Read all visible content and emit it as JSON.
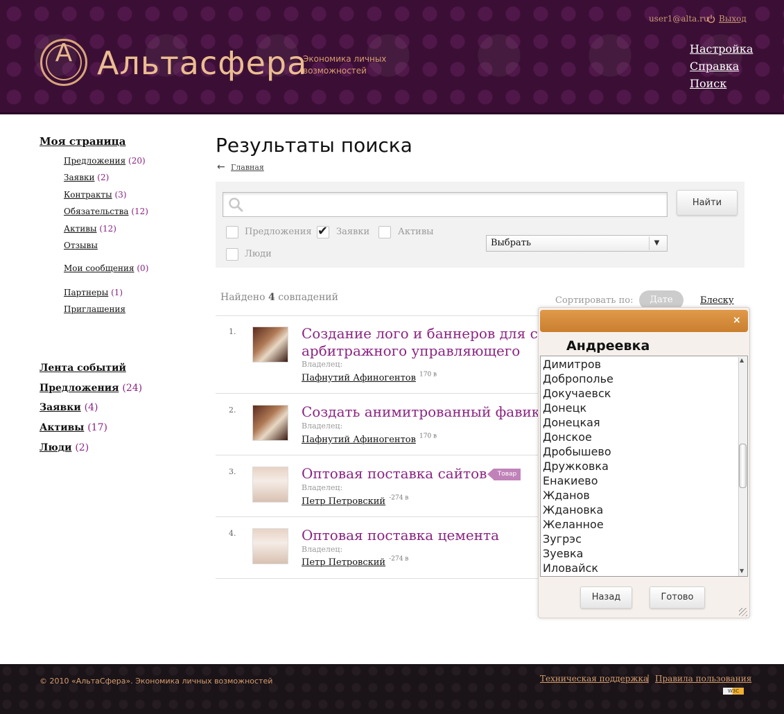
{
  "header": {
    "logo_letter": "A",
    "brand": "Альтасфера",
    "tagline": "Экономика личных возможностей",
    "user_email": "user1@alta.ru",
    "logout": "Выход",
    "links": [
      "Настройка",
      "Справка",
      "Поиск"
    ]
  },
  "sidebar": {
    "my_page": "Моя страница",
    "items": [
      {
        "label": "Предложения",
        "count": "(20)"
      },
      {
        "label": "Заявки",
        "count": "(2)"
      },
      {
        "label": "Контракты",
        "count": "(3)"
      },
      {
        "label": "Обязательства",
        "count": "(12)"
      },
      {
        "label": "Активы",
        "count": "(12)"
      },
      {
        "label": "Отзывы",
        "count": ""
      }
    ],
    "messages": {
      "label": "Мои сообщения",
      "count": "(0)"
    },
    "partners": {
      "label": "Партнеры",
      "count": "(1)"
    },
    "invites": "Приглашения",
    "feed": "Лента событий",
    "sections": [
      {
        "label": "Предложения",
        "count": "(24)"
      },
      {
        "label": "Заявки",
        "count": "(4)"
      },
      {
        "label": "Активы",
        "count": "(17)"
      },
      {
        "label": "Люди",
        "count": "(2)"
      }
    ]
  },
  "main": {
    "title": "Результаты поиска",
    "breadcrumb": "Главная",
    "search": {
      "value": "",
      "placeholder": "",
      "button": "Найти"
    },
    "filters": [
      {
        "label": "Предложения",
        "checked": false
      },
      {
        "label": "Заявки",
        "checked": true
      },
      {
        "label": "Активы",
        "checked": false
      },
      {
        "label": "Люди",
        "checked": false
      }
    ],
    "select_value": "Выбрать",
    "found_prefix": "Найдено",
    "found_count": "4",
    "found_suffix": "совпадений",
    "sort_label": "Сортировать по:",
    "sort_options": [
      "Дате",
      "Блеску"
    ],
    "owner_label": "Владелец:",
    "results": [
      {
        "num": "1.",
        "title_line1": "Создание лого и баннеров для са",
        "title_line2": "арбитражного управляющего",
        "owner": "Пафнутий Афиногентов",
        "price": "170 в",
        "tag": ""
      },
      {
        "num": "2.",
        "title_line1": "Создать анимитрованный фавик",
        "title_line2": "",
        "owner": "Пафнутий Афиногентов",
        "price": "170 в",
        "tag": ""
      },
      {
        "num": "3.",
        "title_line1": "Оптовая поставка сайтов",
        "title_line2": "",
        "owner": "Петр Петровский",
        "price": "-274 в",
        "tag": "Товар"
      },
      {
        "num": "4.",
        "title_line1": "Оптовая поставка цемента",
        "title_line2": "",
        "owner": "Петр Петровский",
        "price": "-274 в",
        "tag": ""
      }
    ]
  },
  "popup": {
    "close": "×",
    "heading": "Андреевка",
    "items": [
      "Димитров",
      "Доброполье",
      "Докучаевск",
      "Донецк",
      "Донецкая",
      "Донское",
      "Дробышево",
      "Дружковка",
      "Енакиево",
      "Жданов",
      "Ждановка",
      "Желанное",
      "Зугрэс",
      "Зуевка",
      "Иловайск"
    ],
    "scroll_up": "▲",
    "scroll_down": "▼",
    "back": "Назад",
    "done": "Готово"
  },
  "footer": {
    "copyright": "© 2010 «АльтаСфера». Экономика личных возможностей",
    "support": "Техническая поддержка",
    "separator": "|",
    "rules": "Правила пользования",
    "badge": "W3C"
  },
  "icons": [
    "power-icon",
    "search-icon",
    "arrow-left-icon",
    "check-icon",
    "chevron-down-icon",
    "close-icon",
    "resize-grip-icon"
  ],
  "colors": {
    "header_bg": "#3b0f35",
    "accent": "#8a2482",
    "popup_bar": "#d58b3a",
    "footer_text": "#d89e70"
  }
}
